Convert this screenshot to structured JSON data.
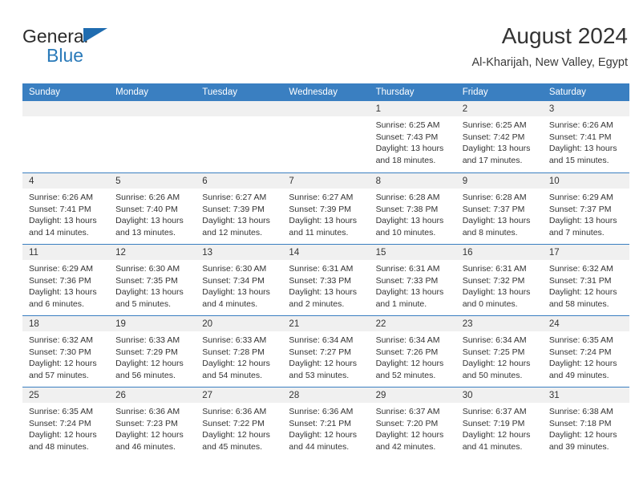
{
  "brand": {
    "name_part1": "General",
    "name_part2": "Blue",
    "accent_color": "#2a7ab9",
    "triangle_color": "#1f6cb0"
  },
  "header": {
    "title": "August 2024",
    "location": "Al-Kharijah, New Valley, Egypt"
  },
  "calendar": {
    "header_bg": "#3a7fc1",
    "weekdays": [
      "Sunday",
      "Monday",
      "Tuesday",
      "Wednesday",
      "Thursday",
      "Friday",
      "Saturday"
    ],
    "weeks": [
      [
        {
          "day": "",
          "sunrise": "",
          "sunset": "",
          "daylight_1": "",
          "daylight_2": ""
        },
        {
          "day": "",
          "sunrise": "",
          "sunset": "",
          "daylight_1": "",
          "daylight_2": ""
        },
        {
          "day": "",
          "sunrise": "",
          "sunset": "",
          "daylight_1": "",
          "daylight_2": ""
        },
        {
          "day": "",
          "sunrise": "",
          "sunset": "",
          "daylight_1": "",
          "daylight_2": ""
        },
        {
          "day": "1",
          "sunrise": "Sunrise: 6:25 AM",
          "sunset": "Sunset: 7:43 PM",
          "daylight_1": "Daylight: 13 hours",
          "daylight_2": "and 18 minutes."
        },
        {
          "day": "2",
          "sunrise": "Sunrise: 6:25 AM",
          "sunset": "Sunset: 7:42 PM",
          "daylight_1": "Daylight: 13 hours",
          "daylight_2": "and 17 minutes."
        },
        {
          "day": "3",
          "sunrise": "Sunrise: 6:26 AM",
          "sunset": "Sunset: 7:41 PM",
          "daylight_1": "Daylight: 13 hours",
          "daylight_2": "and 15 minutes."
        }
      ],
      [
        {
          "day": "4",
          "sunrise": "Sunrise: 6:26 AM",
          "sunset": "Sunset: 7:41 PM",
          "daylight_1": "Daylight: 13 hours",
          "daylight_2": "and 14 minutes."
        },
        {
          "day": "5",
          "sunrise": "Sunrise: 6:26 AM",
          "sunset": "Sunset: 7:40 PM",
          "daylight_1": "Daylight: 13 hours",
          "daylight_2": "and 13 minutes."
        },
        {
          "day": "6",
          "sunrise": "Sunrise: 6:27 AM",
          "sunset": "Sunset: 7:39 PM",
          "daylight_1": "Daylight: 13 hours",
          "daylight_2": "and 12 minutes."
        },
        {
          "day": "7",
          "sunrise": "Sunrise: 6:27 AM",
          "sunset": "Sunset: 7:39 PM",
          "daylight_1": "Daylight: 13 hours",
          "daylight_2": "and 11 minutes."
        },
        {
          "day": "8",
          "sunrise": "Sunrise: 6:28 AM",
          "sunset": "Sunset: 7:38 PM",
          "daylight_1": "Daylight: 13 hours",
          "daylight_2": "and 10 minutes."
        },
        {
          "day": "9",
          "sunrise": "Sunrise: 6:28 AM",
          "sunset": "Sunset: 7:37 PM",
          "daylight_1": "Daylight: 13 hours",
          "daylight_2": "and 8 minutes."
        },
        {
          "day": "10",
          "sunrise": "Sunrise: 6:29 AM",
          "sunset": "Sunset: 7:37 PM",
          "daylight_1": "Daylight: 13 hours",
          "daylight_2": "and 7 minutes."
        }
      ],
      [
        {
          "day": "11",
          "sunrise": "Sunrise: 6:29 AM",
          "sunset": "Sunset: 7:36 PM",
          "daylight_1": "Daylight: 13 hours",
          "daylight_2": "and 6 minutes."
        },
        {
          "day": "12",
          "sunrise": "Sunrise: 6:30 AM",
          "sunset": "Sunset: 7:35 PM",
          "daylight_1": "Daylight: 13 hours",
          "daylight_2": "and 5 minutes."
        },
        {
          "day": "13",
          "sunrise": "Sunrise: 6:30 AM",
          "sunset": "Sunset: 7:34 PM",
          "daylight_1": "Daylight: 13 hours",
          "daylight_2": "and 4 minutes."
        },
        {
          "day": "14",
          "sunrise": "Sunrise: 6:31 AM",
          "sunset": "Sunset: 7:33 PM",
          "daylight_1": "Daylight: 13 hours",
          "daylight_2": "and 2 minutes."
        },
        {
          "day": "15",
          "sunrise": "Sunrise: 6:31 AM",
          "sunset": "Sunset: 7:33 PM",
          "daylight_1": "Daylight: 13 hours",
          "daylight_2": "and 1 minute."
        },
        {
          "day": "16",
          "sunrise": "Sunrise: 6:31 AM",
          "sunset": "Sunset: 7:32 PM",
          "daylight_1": "Daylight: 13 hours",
          "daylight_2": "and 0 minutes."
        },
        {
          "day": "17",
          "sunrise": "Sunrise: 6:32 AM",
          "sunset": "Sunset: 7:31 PM",
          "daylight_1": "Daylight: 12 hours",
          "daylight_2": "and 58 minutes."
        }
      ],
      [
        {
          "day": "18",
          "sunrise": "Sunrise: 6:32 AM",
          "sunset": "Sunset: 7:30 PM",
          "daylight_1": "Daylight: 12 hours",
          "daylight_2": "and 57 minutes."
        },
        {
          "day": "19",
          "sunrise": "Sunrise: 6:33 AM",
          "sunset": "Sunset: 7:29 PM",
          "daylight_1": "Daylight: 12 hours",
          "daylight_2": "and 56 minutes."
        },
        {
          "day": "20",
          "sunrise": "Sunrise: 6:33 AM",
          "sunset": "Sunset: 7:28 PM",
          "daylight_1": "Daylight: 12 hours",
          "daylight_2": "and 54 minutes."
        },
        {
          "day": "21",
          "sunrise": "Sunrise: 6:34 AM",
          "sunset": "Sunset: 7:27 PM",
          "daylight_1": "Daylight: 12 hours",
          "daylight_2": "and 53 minutes."
        },
        {
          "day": "22",
          "sunrise": "Sunrise: 6:34 AM",
          "sunset": "Sunset: 7:26 PM",
          "daylight_1": "Daylight: 12 hours",
          "daylight_2": "and 52 minutes."
        },
        {
          "day": "23",
          "sunrise": "Sunrise: 6:34 AM",
          "sunset": "Sunset: 7:25 PM",
          "daylight_1": "Daylight: 12 hours",
          "daylight_2": "and 50 minutes."
        },
        {
          "day": "24",
          "sunrise": "Sunrise: 6:35 AM",
          "sunset": "Sunset: 7:24 PM",
          "daylight_1": "Daylight: 12 hours",
          "daylight_2": "and 49 minutes."
        }
      ],
      [
        {
          "day": "25",
          "sunrise": "Sunrise: 6:35 AM",
          "sunset": "Sunset: 7:24 PM",
          "daylight_1": "Daylight: 12 hours",
          "daylight_2": "and 48 minutes."
        },
        {
          "day": "26",
          "sunrise": "Sunrise: 6:36 AM",
          "sunset": "Sunset: 7:23 PM",
          "daylight_1": "Daylight: 12 hours",
          "daylight_2": "and 46 minutes."
        },
        {
          "day": "27",
          "sunrise": "Sunrise: 6:36 AM",
          "sunset": "Sunset: 7:22 PM",
          "daylight_1": "Daylight: 12 hours",
          "daylight_2": "and 45 minutes."
        },
        {
          "day": "28",
          "sunrise": "Sunrise: 6:36 AM",
          "sunset": "Sunset: 7:21 PM",
          "daylight_1": "Daylight: 12 hours",
          "daylight_2": "and 44 minutes."
        },
        {
          "day": "29",
          "sunrise": "Sunrise: 6:37 AM",
          "sunset": "Sunset: 7:20 PM",
          "daylight_1": "Daylight: 12 hours",
          "daylight_2": "and 42 minutes."
        },
        {
          "day": "30",
          "sunrise": "Sunrise: 6:37 AM",
          "sunset": "Sunset: 7:19 PM",
          "daylight_1": "Daylight: 12 hours",
          "daylight_2": "and 41 minutes."
        },
        {
          "day": "31",
          "sunrise": "Sunrise: 6:38 AM",
          "sunset": "Sunset: 7:18 PM",
          "daylight_1": "Daylight: 12 hours",
          "daylight_2": "and 39 minutes."
        }
      ]
    ]
  }
}
